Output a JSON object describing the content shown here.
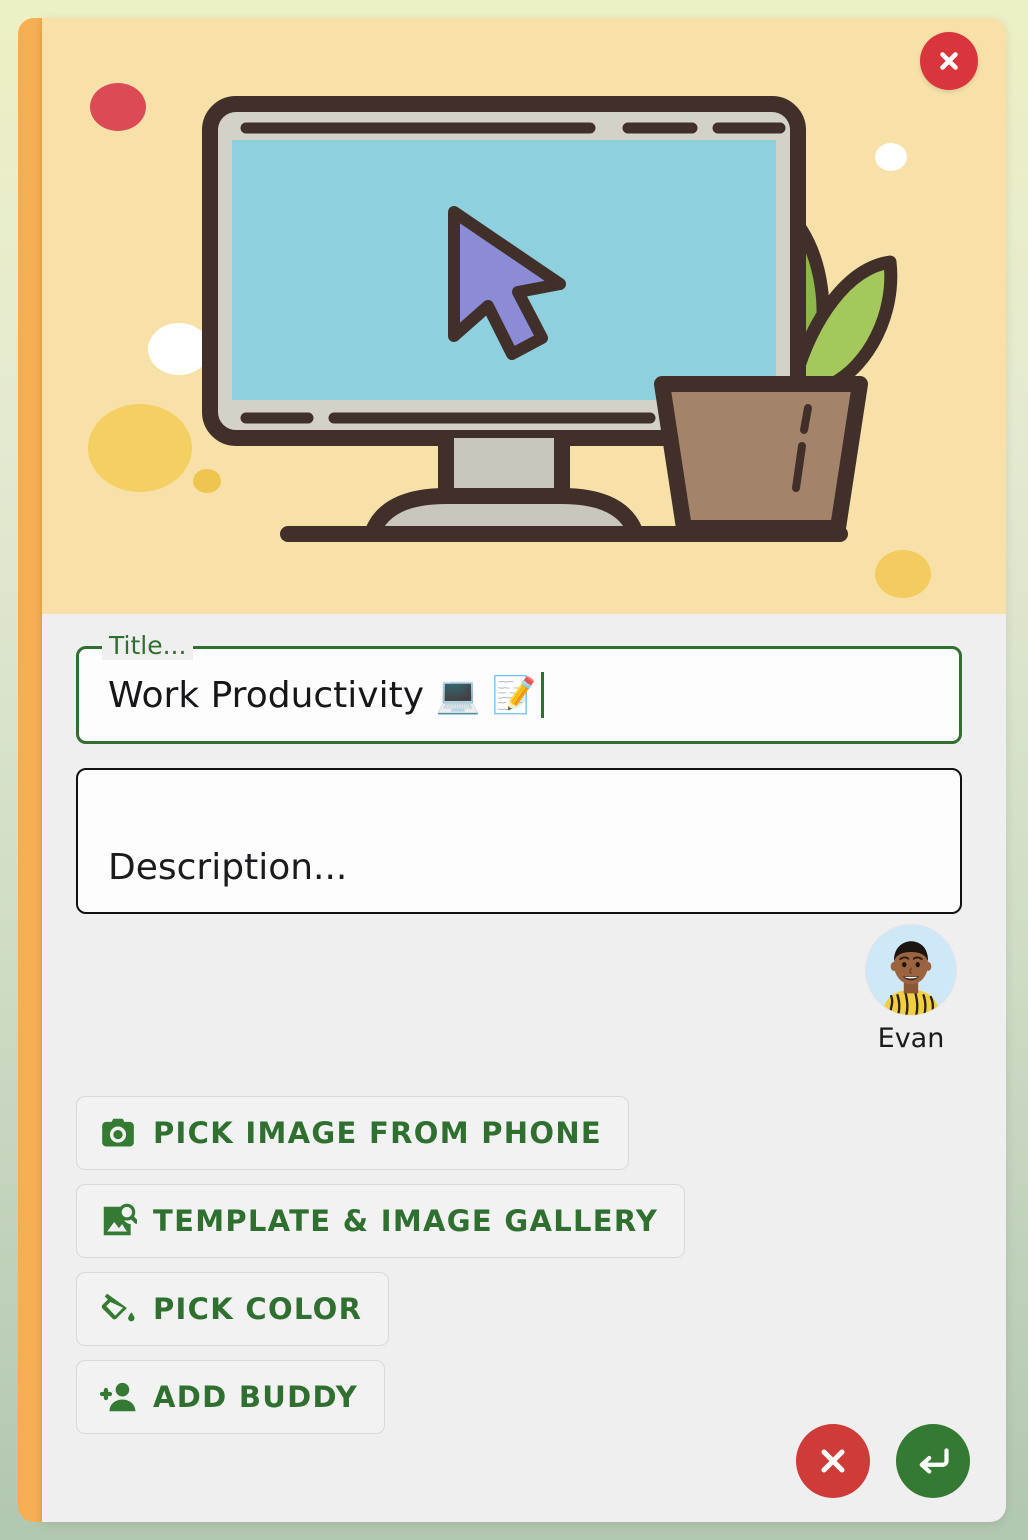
{
  "dialog": {
    "close_label": "close-icon"
  },
  "hero": {
    "illustration_name": "desktop-computer-with-plant-illustration",
    "background_color": "#f7e1a8",
    "screen_color": "#8ed0dd",
    "outline_color": "#41302a",
    "cursor_color": "#8b8bd6",
    "pot_color": "#a3846b",
    "leaf_colors": [
      "#9fc355",
      "#8cb74a",
      "#a5c85c"
    ],
    "dots": [
      {
        "name": "red-dot",
        "color": "#dc4a56"
      },
      {
        "name": "white-dot-large",
        "color": "#ffffff"
      },
      {
        "name": "yellow-dot-large",
        "color": "#f4cf62"
      },
      {
        "name": "yellow-dot-small",
        "color": "#eec64f"
      },
      {
        "name": "white-dot-small",
        "color": "#ffffff"
      },
      {
        "name": "yellow-dot-bottom",
        "color": "#f3cb5e"
      }
    ]
  },
  "title_field": {
    "legend": "Title...",
    "value": "Work Productivity 💻 📝",
    "border_color": "#2f7030"
  },
  "description_field": {
    "placeholder": "Description...",
    "value": ""
  },
  "buddy": {
    "name": "Evan",
    "avatar_name": "evan-avatar"
  },
  "options": [
    {
      "id": "pick-image-from-phone",
      "label": "PICK IMAGE FROM PHONE",
      "icon": "camera-icon"
    },
    {
      "id": "template-image-gallery",
      "label": "TEMPLATE & IMAGE GALLERY",
      "icon": "image-search-icon"
    },
    {
      "id": "pick-color",
      "label": "PICK COLOR",
      "icon": "paint-bucket-icon"
    },
    {
      "id": "add-buddy",
      "label": "ADD BUDDY",
      "icon": "person-add-icon"
    }
  ],
  "actions": {
    "cancel": {
      "label": "cancel-icon",
      "color": "#cf3b38"
    },
    "confirm": {
      "label": "enter-return-icon",
      "color": "#357a32"
    }
  },
  "theme": {
    "accent_green": "#2f7030",
    "accent_orange": "#f6b055",
    "card_background": "#efefef",
    "page_gradient_top": "#edf0c4",
    "page_gradient_bottom": "#b2c7b0"
  }
}
